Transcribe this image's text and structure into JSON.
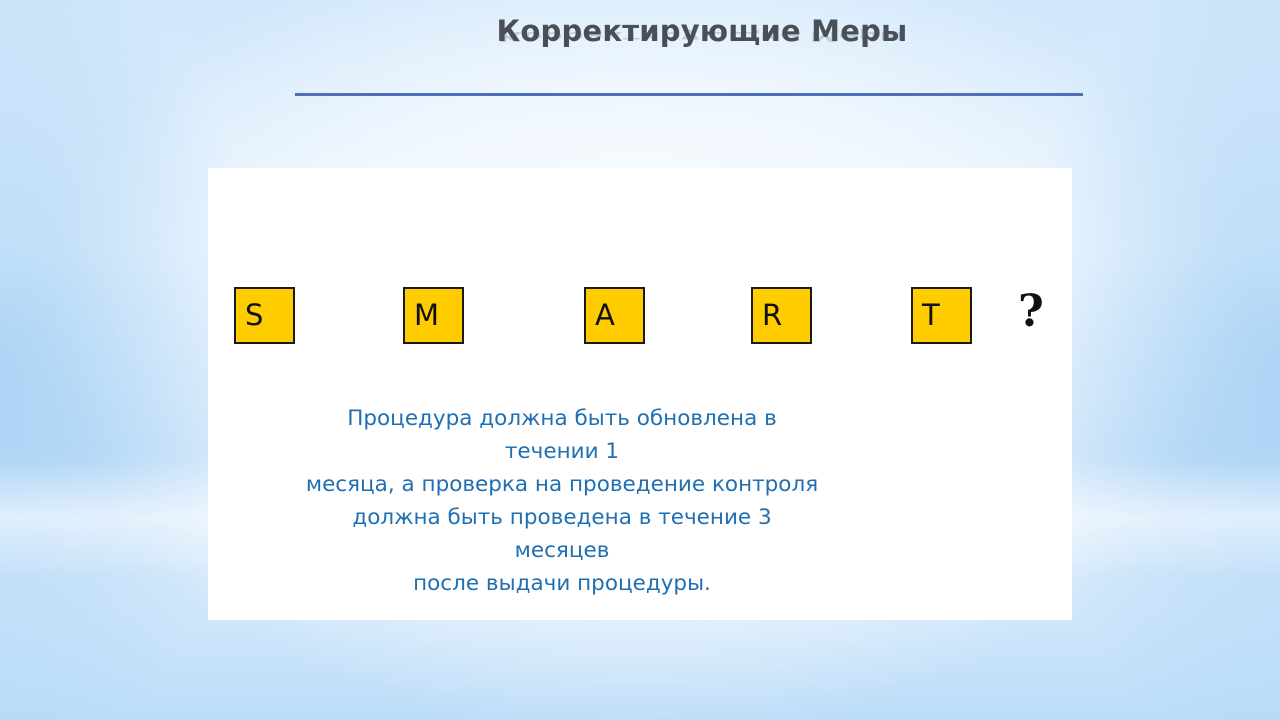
{
  "slide": {
    "title": "Корректирующие Меры",
    "smart_letters": [
      "S",
      "M",
      "A",
      "R",
      "T"
    ],
    "question_mark": "?",
    "body_lines": [
      "Процедура должна быть обновлена в течении 1",
      "месяца, а проверка на проведение контроля",
      "должна быть проведена в течение 3 месяцев",
      "после выдачи процедуры."
    ]
  },
  "colors": {
    "title": "#4a4f57",
    "rule": "#4f6fba",
    "box_fill": "#ffcc00",
    "body_text": "#1f6fb2"
  }
}
